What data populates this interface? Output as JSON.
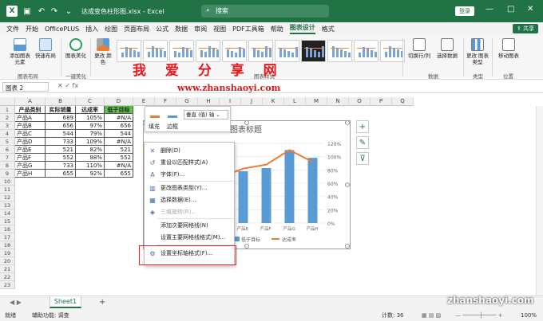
{
  "window": {
    "filename": "达成变色柱形图.xlsx - Excel",
    "search_placeholder": "搜索",
    "login": "登录",
    "minimize": "—",
    "maximize": "□",
    "close": "✕"
  },
  "ribbon_tabs": [
    "文件",
    "开始",
    "OfficePLUS",
    "插入",
    "绘图",
    "页面布局",
    "公式",
    "数据",
    "审阅",
    "视图",
    "PDF工具箱",
    "帮助",
    "图表设计",
    "格式"
  ],
  "active_tab": "图表设计",
  "share": "共享",
  "ribbon": {
    "add_element": "添加图表\n元素",
    "quick_layout": "快速布局",
    "beautify": "图表美化",
    "change_colors": "更改\n颜色",
    "switch_rowcol": "切换行/列",
    "select_data": "选择数据",
    "change_type": "更改\n图表类型",
    "move_chart": "移动图表",
    "groups": {
      "layout": "图表布局",
      "beautify": "一键美化",
      "styles": "图表样式",
      "data": "数据",
      "type": "类型",
      "location": "位置"
    }
  },
  "watermark_cn": "我 爱 分 享 网",
  "watermark_url": "www.zhanshaoyi.com",
  "watermark_bottom": "zhanshaoyi.com",
  "formula_bar": {
    "name_box": "图表 2",
    "fx": "fx"
  },
  "columns": [
    "A",
    "B",
    "C",
    "D",
    "E",
    "F",
    "G",
    "H",
    "I",
    "J",
    "K",
    "L",
    "M",
    "N",
    "O",
    "P",
    "Q"
  ],
  "rows": [
    "1",
    "2",
    "3",
    "4",
    "5",
    "6",
    "7",
    "8",
    "9",
    "10",
    "11",
    "12",
    "13",
    "14",
    "15",
    "16",
    "17",
    "18",
    "19",
    "20",
    "21",
    "22",
    "23"
  ],
  "table": {
    "headers": [
      "产品类别",
      "实际销量",
      "达成率",
      "低于目标"
    ],
    "data": [
      [
        "产品A",
        "689",
        "105%",
        "#N/A"
      ],
      [
        "产品B",
        "656",
        "97%",
        "656"
      ],
      [
        "产品C",
        "544",
        "79%",
        "544"
      ],
      [
        "产品D",
        "733",
        "109%",
        "#N/A"
      ],
      [
        "产品E",
        "521",
        "82%",
        "521"
      ],
      [
        "产品F",
        "552",
        "88%",
        "552"
      ],
      [
        "产品G",
        "733",
        "110%",
        "#N/A"
      ],
      [
        "产品H",
        "655",
        "92%",
        "655"
      ]
    ]
  },
  "format_toolbar": {
    "fill": "填充",
    "outline": "边框",
    "selector": "垂直 (值) 轴"
  },
  "chart_data": {
    "type": "bar",
    "title": "图表标题",
    "categories": [
      "产品E",
      "产品F",
      "产品G",
      "产品H"
    ],
    "series": [
      {
        "name": "低于目标",
        "values": [
          521,
          552,
          733,
          655
        ]
      },
      {
        "name": "达成率",
        "values": [
          82,
          88,
          110,
          92
        ]
      }
    ],
    "y2_ticks": [
      "120%",
      "100%",
      "80%",
      "60%",
      "40%",
      "20%",
      "0%"
    ],
    "colors": {
      "bar": "#5b9bd5",
      "line": "#ed7d31"
    }
  },
  "context_menu": [
    {
      "label": "删除(D)",
      "icon": "delete-icon",
      "disabled": false
    },
    {
      "label": "重设以匹配样式(A)",
      "icon": "reset-icon",
      "disabled": false
    },
    {
      "label": "字体(F)...",
      "icon": "font-icon",
      "disabled": false
    },
    {
      "label": "更改图表类型(Y)...",
      "icon": "chart-type-icon",
      "disabled": false
    },
    {
      "label": "选择数据(E)...",
      "icon": "data-icon",
      "disabled": false
    },
    {
      "label": "三维旋转(R)...",
      "icon": "rotate-icon",
      "disabled": true
    },
    {
      "label": "添加次要网格线(N)",
      "icon": "",
      "disabled": false
    },
    {
      "label": "设置主要网格线格式(M)...",
      "icon": "",
      "disabled": false
    },
    {
      "label": "设置坐标轴格式(F)...",
      "icon": "axis-format-icon",
      "disabled": false
    }
  ],
  "sheet": {
    "name": "Sheet1",
    "add": "+"
  },
  "status": {
    "ready": "就绪",
    "accessibility": "辅助功能: 调查",
    "count": "计数: 36",
    "zoom": "100%"
  }
}
